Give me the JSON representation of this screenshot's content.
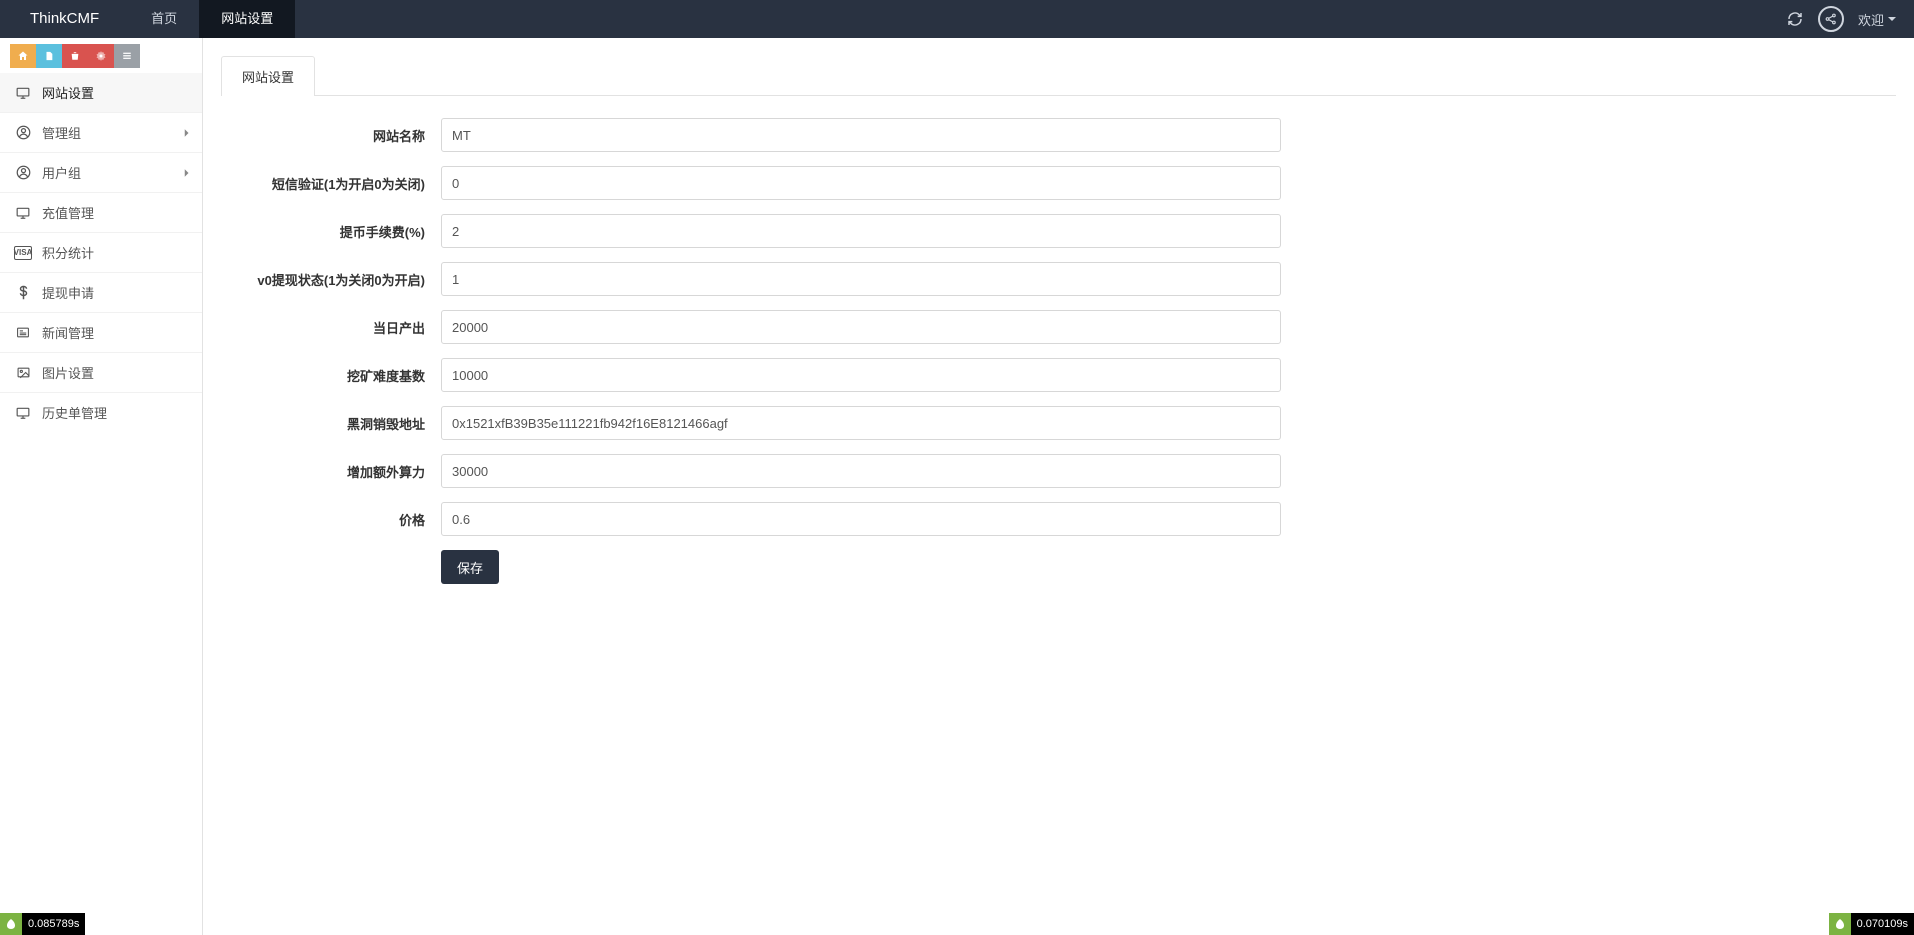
{
  "brand": "ThinkCMF",
  "topnav": {
    "home": "首页",
    "settings": "网站设置",
    "welcome": "欢迎"
  },
  "sidebar": {
    "items": [
      {
        "label": "网站设置",
        "icon": "monitor",
        "has_children": false
      },
      {
        "label": "管理组",
        "icon": "user-circle",
        "has_children": true
      },
      {
        "label": "用户组",
        "icon": "user-circle",
        "has_children": true
      },
      {
        "label": "充值管理",
        "icon": "monitor",
        "has_children": false
      },
      {
        "label": "积分统计",
        "icon": "visa",
        "has_children": false
      },
      {
        "label": "提现申请",
        "icon": "dollar",
        "has_children": false
      },
      {
        "label": "新闻管理",
        "icon": "news",
        "has_children": false
      },
      {
        "label": "图片设置",
        "icon": "image",
        "has_children": false
      },
      {
        "label": "历史单管理",
        "icon": "monitor",
        "has_children": false
      }
    ]
  },
  "tab": {
    "label": "网站设置"
  },
  "form": {
    "fields": [
      {
        "label": "网站名称",
        "value": "MT"
      },
      {
        "label": "短信验证(1为开启0为关闭)",
        "value": "0"
      },
      {
        "label": "提币手续费(%)",
        "value": "2"
      },
      {
        "label": "v0提现状态(1为关闭0为开启)",
        "value": "1"
      },
      {
        "label": "当日产出",
        "value": "20000"
      },
      {
        "label": "挖矿难度基数",
        "value": "10000"
      },
      {
        "label": "黑洞销毁地址",
        "value": "0x1521xfB39B35e111221fb942f16E8121466agf"
      },
      {
        "label": "增加额外算力",
        "value": "30000"
      },
      {
        "label": "价格",
        "value": "0.6"
      }
    ],
    "save": "保存"
  },
  "timers": {
    "left": "0.085789s",
    "right": "0.070109s"
  }
}
